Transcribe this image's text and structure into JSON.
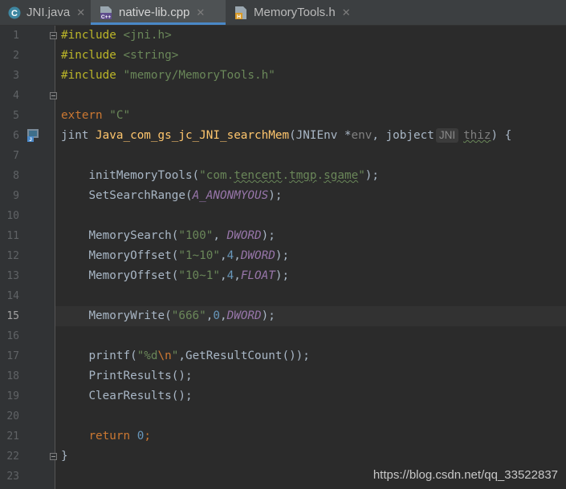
{
  "tabs": [
    {
      "label": "JNI.java",
      "icon": "java-class-icon",
      "active": false
    },
    {
      "label": "native-lib.cpp",
      "icon": "cpp-file-icon",
      "active": true
    },
    {
      "label": "MemoryTools.h",
      "icon": "header-file-icon",
      "active": false
    }
  ],
  "editor": {
    "current_line": 15,
    "line_numbers": [
      "1",
      "2",
      "3",
      "4",
      "5",
      "6",
      "7",
      "8",
      "9",
      "10",
      "11",
      "12",
      "13",
      "14",
      "15",
      "16",
      "17",
      "18",
      "19",
      "20",
      "21",
      "22",
      "23"
    ],
    "lines": {
      "l1": {
        "directive": "#include",
        "target": "<jni.h>"
      },
      "l2": {
        "directive": "#include",
        "target": "<string>"
      },
      "l3": {
        "directive": "#include",
        "target": "\"memory/MemoryTools.h\""
      },
      "l5": {
        "keyword": "extern",
        "string": "\"C\""
      },
      "l6": {
        "ret": "jint",
        "fname": "Java_com_gs_jc_JNI_searchMem",
        "p1_type": "(JNIEnv *",
        "p1_name": "env",
        "sep": ", jobject",
        "hint": "JNI",
        "p2_name": "thiz",
        "end": ") {"
      },
      "l8": {
        "call": "initMemoryTools(",
        "str_a": "\"com.",
        "str_b": "tencent",
        "str_c": ".",
        "str_d": "tmgp",
        "str_e": ".",
        "str_f": "sgame",
        "str_g": "\"",
        "end": ");"
      },
      "l9": {
        "call": "SetSearchRange(",
        "macro": "A_ANONMYOUS",
        "end": ");"
      },
      "l11": {
        "call": "MemorySearch(",
        "str": "\"100\"",
        "comma": ", ",
        "macro": "DWORD",
        "end": ");"
      },
      "l12": {
        "call": "MemoryOffset(",
        "str": "\"1~10\"",
        "c1": ",",
        "num": "4",
        "c2": ",",
        "macro": "DWORD",
        "end": ");"
      },
      "l13": {
        "call": "MemoryOffset(",
        "str": "\"10~1\"",
        "c1": ",",
        "num": "4",
        "c2": ",",
        "macro": "FLOAT",
        "end": ");"
      },
      "l15": {
        "call": "MemoryWrite(",
        "str": "\"666\"",
        "c1": ",",
        "num": "0",
        "c2": ",",
        "macro": "DWORD",
        "end": ");"
      },
      "l17": {
        "call": "printf(",
        "str_a": "\"%d",
        "esc": "\\n",
        "str_b": "\"",
        "rest": ",GetResultCount());"
      },
      "l18": {
        "call": "PrintResults();"
      },
      "l19": {
        "call": "ClearResults();"
      },
      "l21": {
        "keyword": "return",
        "num": "0",
        "end": ";"
      },
      "l22": {
        "brace": "}"
      }
    }
  },
  "watermark": "https://blog.csdn.net/qq_33522837",
  "colors": {
    "background": "#2b2b2b",
    "keyword": "#cc7832",
    "string": "#6a8759",
    "function": "#ffc66d",
    "number": "#6897bb",
    "macro": "#9876aa",
    "active_tab_underline": "#4a88c7"
  }
}
